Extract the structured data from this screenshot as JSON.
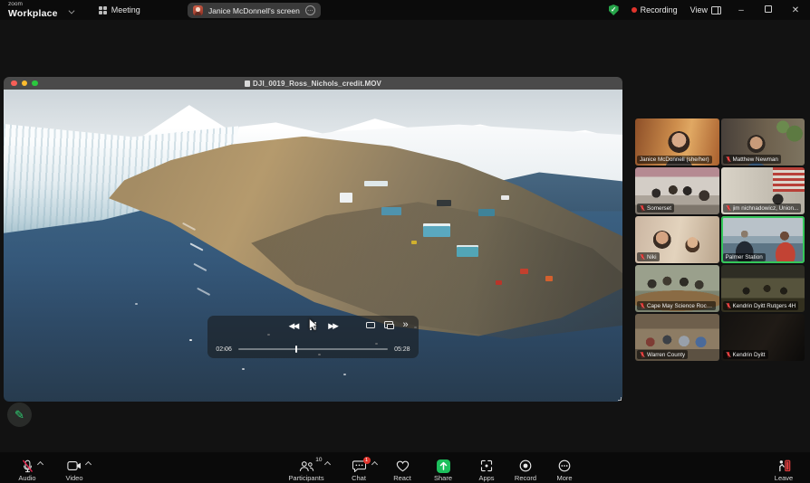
{
  "titlebar": {
    "brand_small": "zoom",
    "brand_large": "Workplace",
    "meeting_tab_label": "Meeting",
    "share_tab_label": "Janice McDonnell's screen",
    "recording_label": "Recording",
    "view_label": "View"
  },
  "player": {
    "window_title": "DJI_0019_Ross_Nichols_credit.MOV",
    "elapsed": "02:06",
    "duration": "05:28",
    "progress_percent": 38
  },
  "participants": [
    {
      "name": "Janice McDonnell (she/her)",
      "muted": false,
      "active": false
    },
    {
      "name": "Matthew Newman",
      "muted": true,
      "active": false
    },
    {
      "name": "Somerset",
      "muted": true,
      "active": false
    },
    {
      "name": "jim nichnadowicz, Union...",
      "muted": true,
      "active": false
    },
    {
      "name": "Niki",
      "muted": true,
      "active": false
    },
    {
      "name": "Palmer Station",
      "muted": false,
      "active": true
    },
    {
      "name": "Cape May Science Rock...",
      "muted": true,
      "active": false
    },
    {
      "name": "Kendrin Dyitt Rutgers 4H",
      "muted": true,
      "active": false
    },
    {
      "name": "Warren County",
      "muted": true,
      "active": false
    },
    {
      "name": "Kendrin Dyitt",
      "muted": true,
      "active": false
    }
  ],
  "toolbar": {
    "audio_label": "Audio",
    "video_label": "Video",
    "participants_label": "Participants",
    "participants_count": "10",
    "chat_label": "Chat",
    "chat_badge": "1",
    "react_label": "React",
    "share_label": "Share",
    "apps_label": "Apps",
    "record_label": "Record",
    "more_label": "More",
    "leave_label": "Leave"
  },
  "colors": {
    "share_green": "#1dbf5c",
    "record_red": "#e0342c",
    "mute_red": "#e02828",
    "active_speaker_green": "#35c75a",
    "leave_red": "#d23b3b",
    "shield_green": "#27a54a"
  }
}
